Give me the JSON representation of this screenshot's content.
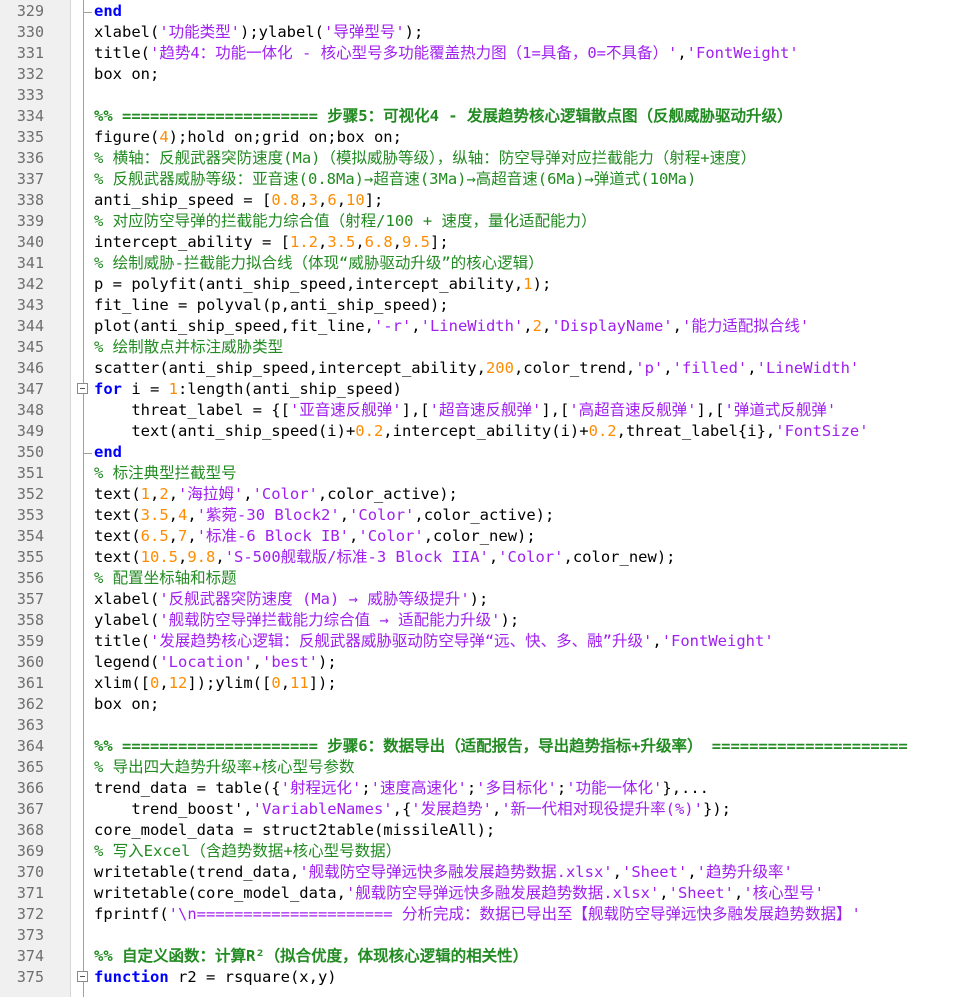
{
  "editor": {
    "lines": [
      {
        "n": "329",
        "fold": "end",
        "t": [
          {
            "c": "kw",
            "v": "end"
          }
        ]
      },
      {
        "n": "330",
        "t": [
          {
            "c": "",
            "v": "xlabel("
          },
          {
            "c": "str",
            "v": "'功能类型'"
          },
          {
            "c": "",
            "v": ");ylabel("
          },
          {
            "c": "str",
            "v": "'导弹型号'"
          },
          {
            "c": "",
            "v": ");"
          }
        ]
      },
      {
        "n": "331",
        "t": [
          {
            "c": "",
            "v": "title("
          },
          {
            "c": "str",
            "v": "'趋势4：功能一体化 - 核心型号多功能覆盖热力图（1=具备，0=不具备）'"
          },
          {
            "c": "",
            "v": ","
          },
          {
            "c": "str",
            "v": "'FontWeight'"
          }
        ]
      },
      {
        "n": "332",
        "t": [
          {
            "c": "",
            "v": "box on;"
          }
        ]
      },
      {
        "n": "333",
        "t": []
      },
      {
        "n": "334",
        "t": [
          {
            "c": "sec",
            "v": "%% ===================== 步骤5：可视化4 - 发展趋势核心逻辑散点图（反舰威胁驱动升级）"
          }
        ]
      },
      {
        "n": "335",
        "t": [
          {
            "c": "",
            "v": "figure("
          },
          {
            "c": "num",
            "v": "4"
          },
          {
            "c": "",
            "v": ");hold on;grid on;box on;"
          }
        ]
      },
      {
        "n": "336",
        "t": [
          {
            "c": "cmt",
            "v": "% 横轴：反舰武器突防速度(Ma)（模拟威胁等级），纵轴：防空导弹对应拦截能力（射程+速度）"
          }
        ]
      },
      {
        "n": "337",
        "t": [
          {
            "c": "cmt",
            "v": "% 反舰武器威胁等级：亚音速(0.8Ma)→超音速(3Ma)→高超音速(6Ma)→弹道式(10Ma)"
          }
        ]
      },
      {
        "n": "338",
        "t": [
          {
            "c": "",
            "v": "anti_ship_speed = ["
          },
          {
            "c": "num",
            "v": "0.8"
          },
          {
            "c": "",
            "v": ","
          },
          {
            "c": "num",
            "v": "3"
          },
          {
            "c": "",
            "v": ","
          },
          {
            "c": "num",
            "v": "6"
          },
          {
            "c": "",
            "v": ","
          },
          {
            "c": "num",
            "v": "10"
          },
          {
            "c": "",
            "v": "];"
          }
        ]
      },
      {
        "n": "339",
        "t": [
          {
            "c": "cmt",
            "v": "% 对应防空导弹的拦截能力综合值（射程/100 + 速度，量化适配能力）"
          }
        ]
      },
      {
        "n": "340",
        "t": [
          {
            "c": "",
            "v": "intercept_ability = ["
          },
          {
            "c": "num",
            "v": "1.2"
          },
          {
            "c": "",
            "v": ","
          },
          {
            "c": "num",
            "v": "3.5"
          },
          {
            "c": "",
            "v": ","
          },
          {
            "c": "num",
            "v": "6.8"
          },
          {
            "c": "",
            "v": ","
          },
          {
            "c": "num",
            "v": "9.5"
          },
          {
            "c": "",
            "v": "];"
          }
        ]
      },
      {
        "n": "341",
        "t": [
          {
            "c": "cmt",
            "v": "% 绘制威胁-拦截能力拟合线（体现“威胁驱动升级”的核心逻辑）"
          }
        ]
      },
      {
        "n": "342",
        "t": [
          {
            "c": "",
            "v": "p = polyfit(anti_ship_speed,intercept_ability,"
          },
          {
            "c": "num",
            "v": "1"
          },
          {
            "c": "",
            "v": ");"
          }
        ]
      },
      {
        "n": "343",
        "t": [
          {
            "c": "",
            "v": "fit_line = polyval(p,anti_ship_speed);"
          }
        ]
      },
      {
        "n": "344",
        "t": [
          {
            "c": "",
            "v": "plot(anti_ship_speed,fit_line,"
          },
          {
            "c": "str",
            "v": "'-r'"
          },
          {
            "c": "",
            "v": ","
          },
          {
            "c": "str",
            "v": "'LineWidth'"
          },
          {
            "c": "",
            "v": ","
          },
          {
            "c": "num",
            "v": "2"
          },
          {
            "c": "",
            "v": ","
          },
          {
            "c": "str",
            "v": "'DisplayName'"
          },
          {
            "c": "",
            "v": ","
          },
          {
            "c": "str",
            "v": "'能力适配拟合线'"
          }
        ]
      },
      {
        "n": "345",
        "t": [
          {
            "c": "cmt",
            "v": "% 绘制散点并标注威胁类型"
          }
        ]
      },
      {
        "n": "346",
        "t": [
          {
            "c": "",
            "v": "scatter(anti_ship_speed,intercept_ability,"
          },
          {
            "c": "num",
            "v": "200"
          },
          {
            "c": "",
            "v": ",color_trend,"
          },
          {
            "c": "str",
            "v": "'p'"
          },
          {
            "c": "",
            "v": ","
          },
          {
            "c": "str",
            "v": "'filled'"
          },
          {
            "c": "",
            "v": ","
          },
          {
            "c": "str",
            "v": "'LineWidth'"
          }
        ]
      },
      {
        "n": "347",
        "fold": "start",
        "t": [
          {
            "c": "kw",
            "v": "for"
          },
          {
            "c": "",
            "v": " i = "
          },
          {
            "c": "num",
            "v": "1"
          },
          {
            "c": "",
            "v": ":length(anti_ship_speed)"
          }
        ]
      },
      {
        "n": "348",
        "t": [
          {
            "c": "",
            "v": "    threat_label = {["
          },
          {
            "c": "str",
            "v": "'亚音速反舰弹'"
          },
          {
            "c": "",
            "v": "],["
          },
          {
            "c": "str",
            "v": "'超音速反舰弹'"
          },
          {
            "c": "",
            "v": "],["
          },
          {
            "c": "str",
            "v": "'高超音速反舰弹'"
          },
          {
            "c": "",
            "v": "],["
          },
          {
            "c": "str",
            "v": "'弹道式反舰弹'"
          }
        ]
      },
      {
        "n": "349",
        "t": [
          {
            "c": "",
            "v": "    text(anti_ship_speed(i)+"
          },
          {
            "c": "num",
            "v": "0.2"
          },
          {
            "c": "",
            "v": ",intercept_ability(i)+"
          },
          {
            "c": "num",
            "v": "0.2"
          },
          {
            "c": "",
            "v": ",threat_label{i},"
          },
          {
            "c": "str",
            "v": "'FontSize'"
          }
        ]
      },
      {
        "n": "350",
        "fold": "end",
        "t": [
          {
            "c": "kw",
            "v": "end"
          }
        ]
      },
      {
        "n": "351",
        "t": [
          {
            "c": "cmt",
            "v": "% 标注典型拦截型号"
          }
        ]
      },
      {
        "n": "352",
        "t": [
          {
            "c": "",
            "v": "text("
          },
          {
            "c": "num",
            "v": "1"
          },
          {
            "c": "",
            "v": ","
          },
          {
            "c": "num",
            "v": "2"
          },
          {
            "c": "",
            "v": ","
          },
          {
            "c": "str",
            "v": "'海拉姆'"
          },
          {
            "c": "",
            "v": ","
          },
          {
            "c": "str",
            "v": "'Color'"
          },
          {
            "c": "",
            "v": ",color_active);"
          }
        ]
      },
      {
        "n": "353",
        "t": [
          {
            "c": "",
            "v": "text("
          },
          {
            "c": "num",
            "v": "3.5"
          },
          {
            "c": "",
            "v": ","
          },
          {
            "c": "num",
            "v": "4"
          },
          {
            "c": "",
            "v": ","
          },
          {
            "c": "str",
            "v": "'紫菀-30 Block2'"
          },
          {
            "c": "",
            "v": ","
          },
          {
            "c": "str",
            "v": "'Color'"
          },
          {
            "c": "",
            "v": ",color_active);"
          }
        ]
      },
      {
        "n": "354",
        "t": [
          {
            "c": "",
            "v": "text("
          },
          {
            "c": "num",
            "v": "6.5"
          },
          {
            "c": "",
            "v": ","
          },
          {
            "c": "num",
            "v": "7"
          },
          {
            "c": "",
            "v": ","
          },
          {
            "c": "str",
            "v": "'标准-6 Block IB'"
          },
          {
            "c": "",
            "v": ","
          },
          {
            "c": "str",
            "v": "'Color'"
          },
          {
            "c": "",
            "v": ",color_new);"
          }
        ]
      },
      {
        "n": "355",
        "t": [
          {
            "c": "",
            "v": "text("
          },
          {
            "c": "num",
            "v": "10.5"
          },
          {
            "c": "",
            "v": ","
          },
          {
            "c": "num",
            "v": "9.8"
          },
          {
            "c": "",
            "v": ","
          },
          {
            "c": "str",
            "v": "'S-500舰载版/标准-3 Block IIA'"
          },
          {
            "c": "",
            "v": ","
          },
          {
            "c": "str",
            "v": "'Color'"
          },
          {
            "c": "",
            "v": ",color_new);"
          }
        ]
      },
      {
        "n": "356",
        "t": [
          {
            "c": "cmt",
            "v": "% 配置坐标轴和标题"
          }
        ]
      },
      {
        "n": "357",
        "t": [
          {
            "c": "",
            "v": "xlabel("
          },
          {
            "c": "str",
            "v": "'反舰武器突防速度 (Ma) → 威胁等级提升'"
          },
          {
            "c": "",
            "v": ");"
          }
        ]
      },
      {
        "n": "358",
        "t": [
          {
            "c": "",
            "v": "ylabel("
          },
          {
            "c": "str",
            "v": "'舰载防空导弹拦截能力综合值 → 适配能力升级'"
          },
          {
            "c": "",
            "v": ");"
          }
        ]
      },
      {
        "n": "359",
        "t": [
          {
            "c": "",
            "v": "title("
          },
          {
            "c": "str",
            "v": "'发展趋势核心逻辑：反舰武器威胁驱动防空导弹“远、快、多、融”升级'"
          },
          {
            "c": "",
            "v": ","
          },
          {
            "c": "str",
            "v": "'FontWeight'"
          }
        ]
      },
      {
        "n": "360",
        "t": [
          {
            "c": "",
            "v": "legend("
          },
          {
            "c": "str",
            "v": "'Location'"
          },
          {
            "c": "",
            "v": ","
          },
          {
            "c": "str",
            "v": "'best'"
          },
          {
            "c": "",
            "v": ");"
          }
        ]
      },
      {
        "n": "361",
        "t": [
          {
            "c": "",
            "v": "xlim(["
          },
          {
            "c": "num",
            "v": "0"
          },
          {
            "c": "",
            "v": ","
          },
          {
            "c": "num",
            "v": "12"
          },
          {
            "c": "",
            "v": "]);ylim(["
          },
          {
            "c": "num",
            "v": "0"
          },
          {
            "c": "",
            "v": ","
          },
          {
            "c": "num",
            "v": "11"
          },
          {
            "c": "",
            "v": "]);"
          }
        ]
      },
      {
        "n": "362",
        "t": [
          {
            "c": "",
            "v": "box on;"
          }
        ]
      },
      {
        "n": "363",
        "t": []
      },
      {
        "n": "364",
        "t": [
          {
            "c": "sec",
            "v": "%% ===================== 步骤6：数据导出（适配报告，导出趋势指标+升级率） ====================="
          }
        ]
      },
      {
        "n": "365",
        "t": [
          {
            "c": "cmt",
            "v": "% 导出四大趋势升级率+核心型号参数"
          }
        ]
      },
      {
        "n": "366",
        "t": [
          {
            "c": "",
            "v": "trend_data = table({"
          },
          {
            "c": "str",
            "v": "'射程远化'"
          },
          {
            "c": "",
            "v": ";"
          },
          {
            "c": "str",
            "v": "'速度高速化'"
          },
          {
            "c": "",
            "v": ";"
          },
          {
            "c": "str",
            "v": "'多目标化'"
          },
          {
            "c": "",
            "v": ";"
          },
          {
            "c": "str",
            "v": "'功能一体化'"
          },
          {
            "c": "",
            "v": "},..."
          }
        ]
      },
      {
        "n": "367",
        "t": [
          {
            "c": "",
            "v": "    trend_boost',"
          },
          {
            "c": "str",
            "v": "'VariableNames'"
          },
          {
            "c": "",
            "v": ",{"
          },
          {
            "c": "str",
            "v": "'发展趋势'"
          },
          {
            "c": "",
            "v": ","
          },
          {
            "c": "str",
            "v": "'新一代相对现役提升率(%)'"
          },
          {
            "c": "",
            "v": "});"
          }
        ]
      },
      {
        "n": "368",
        "t": [
          {
            "c": "",
            "v": "core_model_data = struct2table(missileAll);"
          }
        ]
      },
      {
        "n": "369",
        "t": [
          {
            "c": "cmt",
            "v": "% 写入Excel（含趋势数据+核心型号数据）"
          }
        ]
      },
      {
        "n": "370",
        "t": [
          {
            "c": "",
            "v": "writetable(trend_data,"
          },
          {
            "c": "str",
            "v": "'舰载防空导弹远快多融发展趋势数据.xlsx'"
          },
          {
            "c": "",
            "v": ","
          },
          {
            "c": "str",
            "v": "'Sheet'"
          },
          {
            "c": "",
            "v": ","
          },
          {
            "c": "str",
            "v": "'趋势升级率'"
          }
        ]
      },
      {
        "n": "371",
        "t": [
          {
            "c": "",
            "v": "writetable(core_model_data,"
          },
          {
            "c": "str",
            "v": "'舰载防空导弹远快多融发展趋势数据.xlsx'"
          },
          {
            "c": "",
            "v": ","
          },
          {
            "c": "str",
            "v": "'Sheet'"
          },
          {
            "c": "",
            "v": ","
          },
          {
            "c": "str",
            "v": "'核心型号'"
          }
        ]
      },
      {
        "n": "372",
        "t": [
          {
            "c": "",
            "v": "fprintf("
          },
          {
            "c": "str",
            "v": "'\\n===================== 分析完成：数据已导出至【舰载防空导弹远快多融发展趋势数据】'"
          }
        ]
      },
      {
        "n": "373",
        "t": []
      },
      {
        "n": "374",
        "t": [
          {
            "c": "sec",
            "v": "%% 自定义函数：计算R²（拟合优度，体现核心逻辑的相关性）"
          }
        ]
      },
      {
        "n": "375",
        "fold": "start",
        "t": [
          {
            "c": "kw",
            "v": "function"
          },
          {
            "c": "",
            "v": " r2 = rsquare(x,y)"
          }
        ]
      }
    ]
  }
}
